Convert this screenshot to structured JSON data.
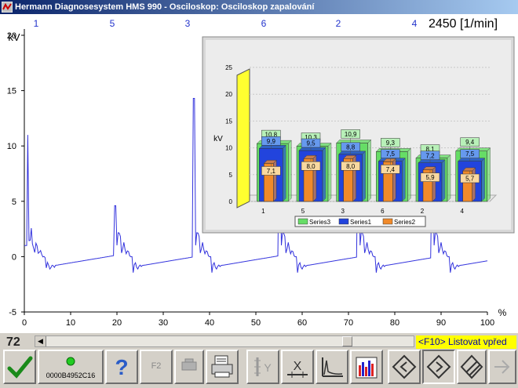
{
  "window": {
    "title": "Hermann Diagnosesystem HMS 990 - Osciloskop: Osciloskop zapalování"
  },
  "scope": {
    "y_unit": "kV",
    "y_ticks": [
      "20",
      "15",
      "10",
      "5",
      "0",
      "-5"
    ],
    "x_ticks": [
      "0",
      "10",
      "20",
      "30",
      "40",
      "50",
      "60",
      "70",
      "80",
      "90",
      "100"
    ],
    "x_unit": "%",
    "cylinder_labels": [
      "1",
      "5",
      "3",
      "6",
      "2",
      "4"
    ],
    "rpm_readout": "2450 [1/min]",
    "trace_color": "#3333dd"
  },
  "inset_chart": {
    "y_axis_label": "kV",
    "y_ticks": [
      "25",
      "20",
      "15",
      "10",
      "5",
      "0"
    ],
    "legend": [
      "Series3",
      "Series1",
      "Series2"
    ]
  },
  "chart_data": {
    "type": "bar",
    "categories": [
      "1",
      "5",
      "3",
      "6",
      "2",
      "4"
    ],
    "ylabel": "kV",
    "ylim": [
      0,
      25
    ],
    "series": [
      {
        "name": "Series3",
        "color": "#66dd66",
        "values": [
          10.8,
          10.3,
          10.9,
          9.3,
          8.1,
          9.4
        ],
        "labels": [
          "10,8",
          "10,3",
          "10,9",
          "9,3",
          "8,1",
          "9,4"
        ]
      },
      {
        "name": "Series1",
        "color": "#2244dd",
        "values": [
          9.9,
          9.5,
          8.8,
          7.5,
          7.2,
          7.5
        ],
        "labels": [
          "9,9",
          "9,5",
          "8,8",
          "7,5",
          "7,2",
          "7,5"
        ]
      },
      {
        "name": "Series2",
        "color": "#f08a2a",
        "values": [
          7.1,
          8.0,
          8.0,
          7.4,
          5.9,
          5.7
        ],
        "labels": [
          "7,1",
          "8,0",
          "8,0",
          "7,4",
          "5,9",
          "5,7"
        ]
      }
    ]
  },
  "bottom": {
    "frame_number": "72",
    "f10_hint": "<F10> Listovat vpřed",
    "status_code": "0000B4952C16",
    "f2_label": "F2",
    "scroll_position": 0.83
  }
}
